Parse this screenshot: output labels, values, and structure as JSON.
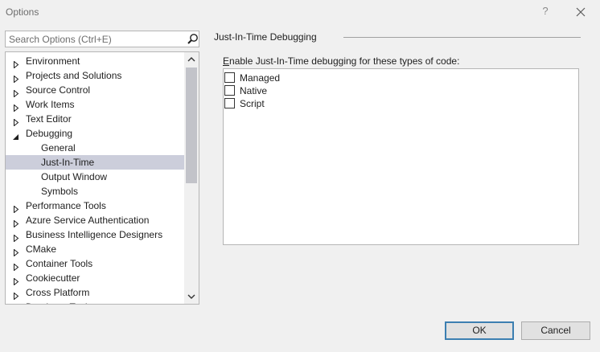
{
  "window": {
    "title": "Options",
    "help_label": "?"
  },
  "search": {
    "placeholder": "Search Options (Ctrl+E)"
  },
  "tree": {
    "items": [
      {
        "label": "Environment",
        "expander": "collapsed"
      },
      {
        "label": "Projects and Solutions",
        "expander": "collapsed"
      },
      {
        "label": "Source Control",
        "expander": "collapsed"
      },
      {
        "label": "Work Items",
        "expander": "collapsed"
      },
      {
        "label": "Text Editor",
        "expander": "collapsed"
      },
      {
        "label": "Debugging",
        "expander": "expanded"
      },
      {
        "label": "General",
        "child": true
      },
      {
        "label": "Just-In-Time",
        "child": true,
        "selected": true
      },
      {
        "label": "Output Window",
        "child": true
      },
      {
        "label": "Symbols",
        "child": true
      },
      {
        "label": "Performance Tools",
        "expander": "collapsed"
      },
      {
        "label": "Azure Service Authentication",
        "expander": "collapsed"
      },
      {
        "label": "Business Intelligence Designers",
        "expander": "collapsed"
      },
      {
        "label": "CMake",
        "expander": "collapsed"
      },
      {
        "label": "Container Tools",
        "expander": "collapsed"
      },
      {
        "label": "Cookiecutter",
        "expander": "collapsed"
      },
      {
        "label": "Cross Platform",
        "expander": "collapsed"
      },
      {
        "label": "Database Tools",
        "expander": "collapsed"
      }
    ]
  },
  "page": {
    "title": "Just-In-Time Debugging",
    "group_label_mnemonic": "E",
    "group_label_rest": "nable Just-In-Time debugging for these types of code:",
    "code_types": [
      {
        "label": "Managed",
        "checked": false
      },
      {
        "label": "Native",
        "checked": false
      },
      {
        "label": "Script",
        "checked": false
      }
    ]
  },
  "buttons": {
    "ok": "OK",
    "cancel": "Cancel"
  },
  "colors": {
    "selection": "#cccedb",
    "default_button_border": "#3c7fb1"
  }
}
